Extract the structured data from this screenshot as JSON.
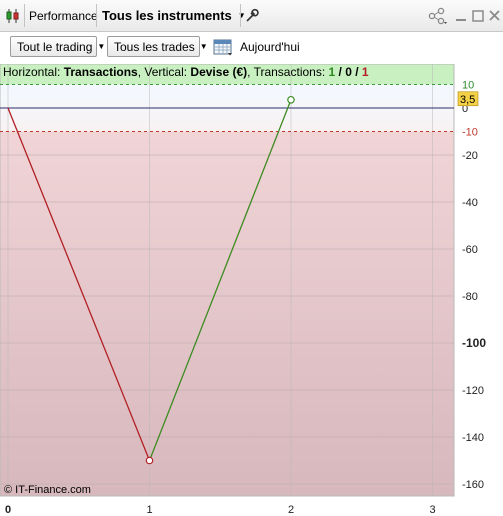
{
  "window": {
    "panel_label": "Performance",
    "instruments_label": "Tous les instruments",
    "icons": [
      "candlestick-icon",
      "wrench-icon",
      "share-icon",
      "minimize-icon",
      "restore-icon",
      "close-icon"
    ]
  },
  "toolbar": {
    "scope_label": "Tout le trading",
    "trades_label": "Tous les trades",
    "date_label": "Aujourd'hui"
  },
  "info": {
    "horizontal_prefix": "Horizontal: ",
    "horizontal_value": "Transactions",
    "vertical_prefix": ", Vertical: ",
    "vertical_value": "Devise (€)",
    "transactions_prefix": ", Transactions: ",
    "tx_total": "1",
    "tx_sep1": " / ",
    "tx_zero": "0",
    "tx_sep2": " / ",
    "tx_loss": "1"
  },
  "chart_data": {
    "type": "line",
    "xlabel": "",
    "ylabel": "",
    "x_ticks": [
      "0",
      "1",
      "2",
      "3"
    ],
    "y_ticks": [
      "10",
      "0",
      "-10",
      "-20",
      "-40",
      "-60",
      "-80",
      "-100",
      "-120",
      "-140",
      "-160"
    ],
    "x": [
      0,
      1,
      2
    ],
    "y": [
      0,
      -150,
      3.5
    ],
    "last_value_label": "3,5",
    "upper_band": 10,
    "lower_band": -10,
    "xlim": [
      0,
      3.1
    ],
    "ylim": [
      -165,
      10
    ],
    "colors": {
      "down": "#b21f24",
      "up": "#3d8b22",
      "profit_zone": "#c8f0c0",
      "loss_zone": "#e4c9cb",
      "value_marker": "#f3d046"
    }
  },
  "copyright": "© IT-Finance.com"
}
